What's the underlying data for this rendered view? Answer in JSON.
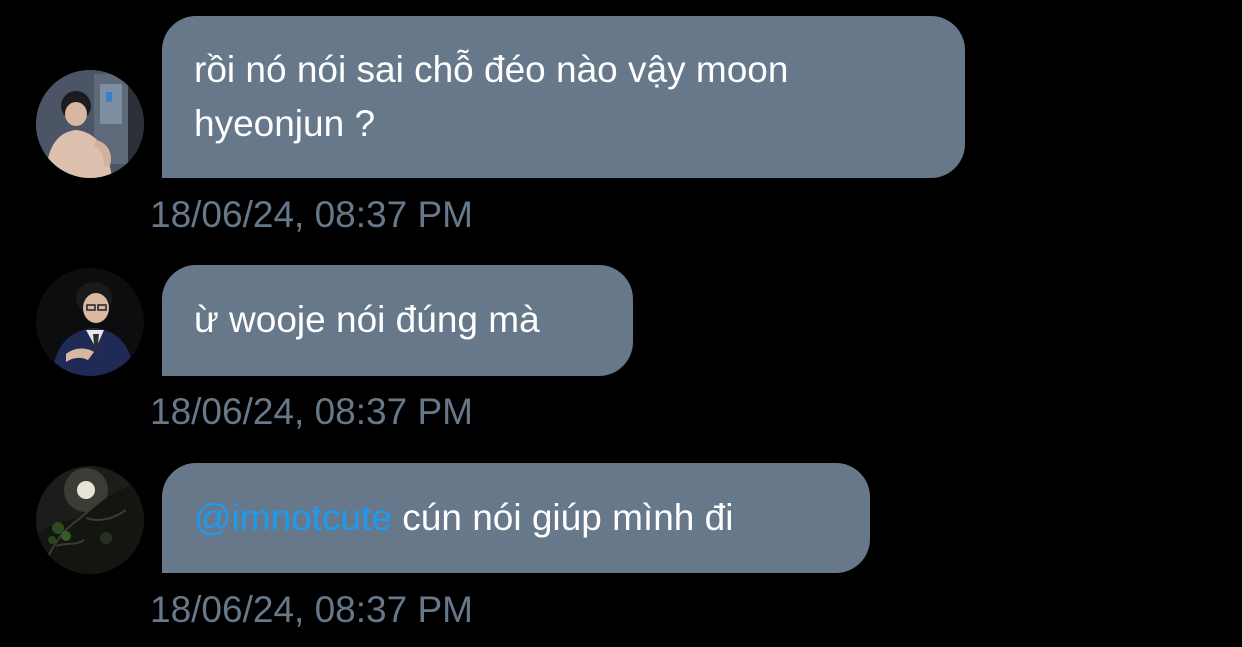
{
  "messages": [
    {
      "avatar_icon": "user-avatar-photo-indoor",
      "text_lines": [
        "rồi nó nói sai chỗ đéo nào vậy moon",
        "hyeonjun ?"
      ],
      "timestamp": "18/06/24, 08:37 PM"
    },
    {
      "avatar_icon": "user-avatar-photo-suit",
      "text": "ừ wooje nói đúng mà",
      "timestamp": "18/06/24, 08:37 PM"
    },
    {
      "avatar_icon": "user-avatar-photo-night-tree",
      "mention": "@imnotcute",
      "text": " cún nói giúp mình đi",
      "timestamp": "18/06/24, 08:37 PM"
    }
  ],
  "colors": {
    "background": "#000000",
    "bubble": "#66788a",
    "bubble_text": "#ffffff",
    "mention": "#1d9bf0",
    "timestamp": "#66788a"
  }
}
